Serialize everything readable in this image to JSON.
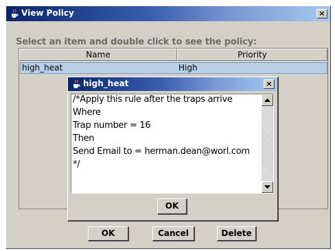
{
  "main_window": {
    "title": "View Policy",
    "close_glyph": "×",
    "instruction": "Select an item and double click to see the policy:",
    "table": {
      "columns": [
        "Name",
        "Priority"
      ],
      "rows": [
        {
          "name": "high_heat",
          "priority": "High"
        }
      ]
    },
    "buttons": {
      "ok": "OK",
      "cancel": "Cancel",
      "delete": "Delete"
    }
  },
  "dialog": {
    "title": "high_heat",
    "close_glyph": "×",
    "text_lines": [
      "/*Apply this rule after the traps arrive",
      "Where",
      "Trap number = 16",
      "Then",
      "Send Email to = herman.dean@worl.com",
      "*/"
    ],
    "ok_label": "OK"
  },
  "icons": {
    "window_icon": "java-cup-icon",
    "close": "close-icon",
    "scroll_up": "arrow-up-icon",
    "scroll_down": "arrow-down-icon"
  },
  "colors": {
    "titlebar_start": "#0a246a",
    "titlebar_end": "#a6caf0",
    "window_bg": "#d4d0c8",
    "selected_row": "#b8cfe8"
  }
}
